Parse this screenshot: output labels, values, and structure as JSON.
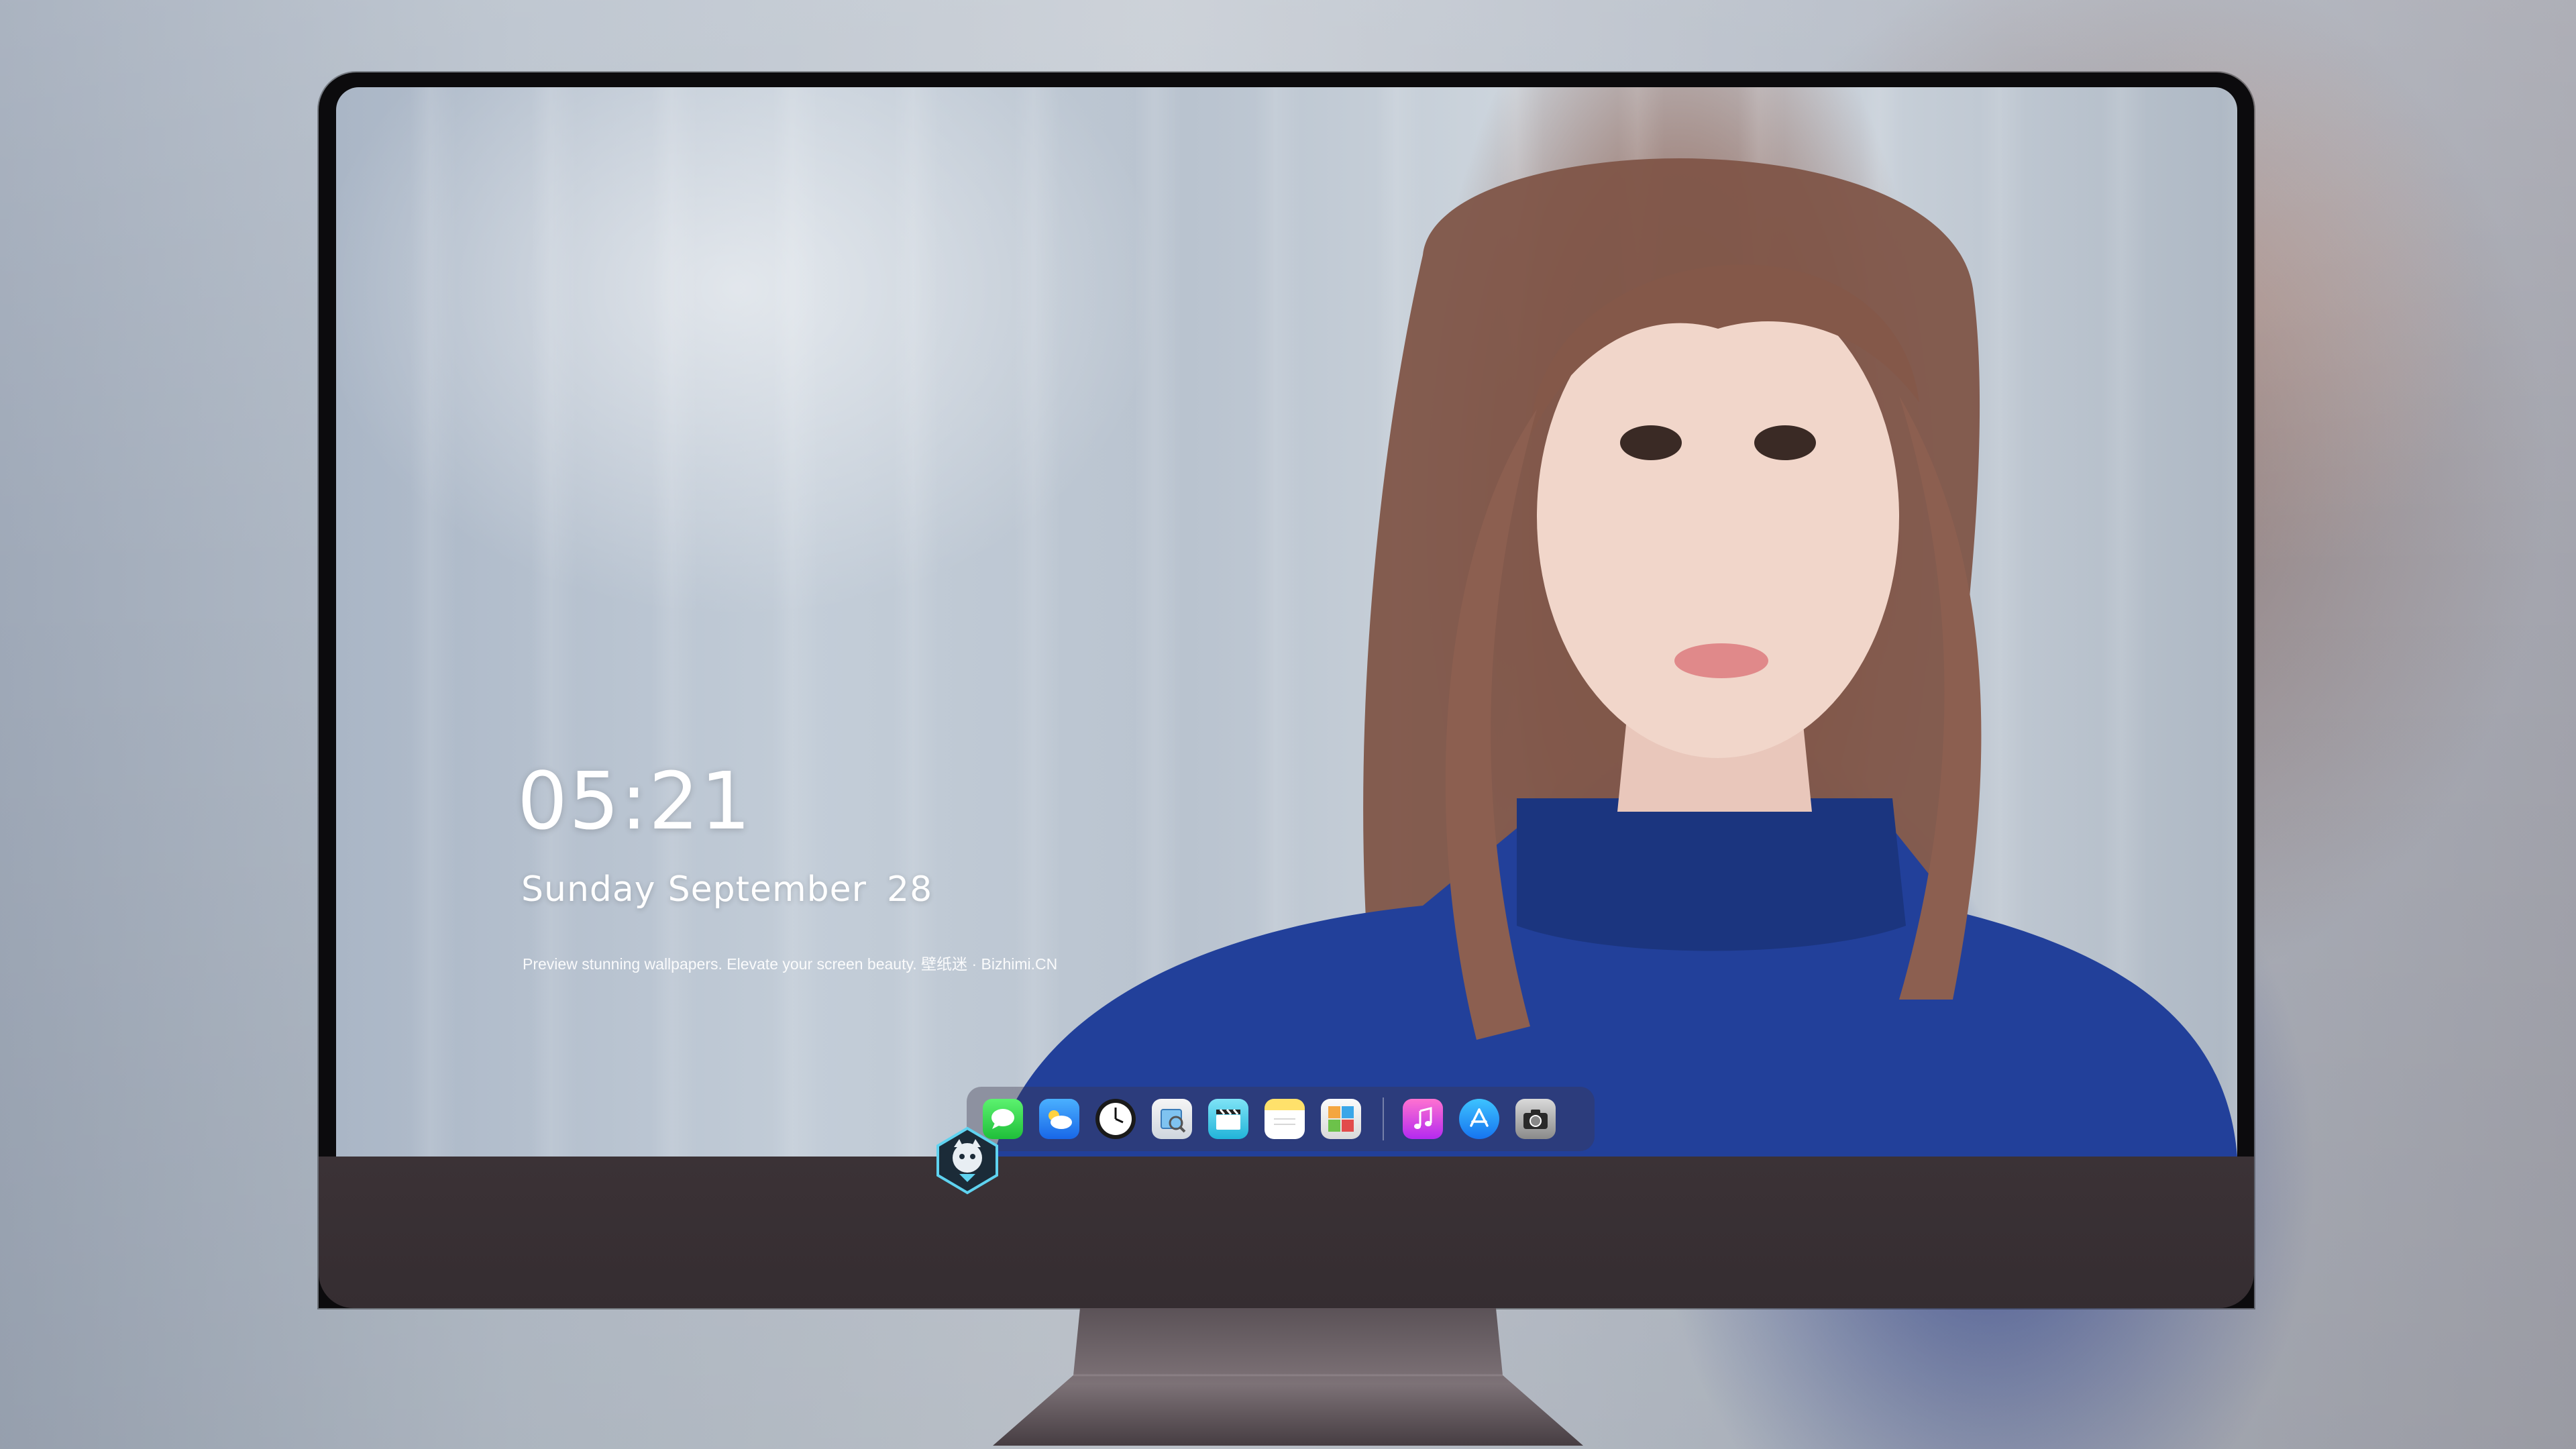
{
  "lock_screen": {
    "time": "05:21",
    "weekday": "Sunday",
    "month": "September",
    "day": "28",
    "tagline": "Preview stunning wallpapers. Elevate your screen beauty. 壁纸迷 · Bizhimi.CN"
  },
  "dock": {
    "items": [
      {
        "name": "messages",
        "icon": "speech-bubble-icon"
      },
      {
        "name": "weather",
        "icon": "cloud-icon"
      },
      {
        "name": "clock",
        "icon": "clock-icon"
      },
      {
        "name": "preview",
        "icon": "preview-icon"
      },
      {
        "name": "clips",
        "icon": "clapperboard-icon"
      },
      {
        "name": "notes",
        "icon": "notes-icon"
      },
      {
        "name": "photos",
        "icon": "photo-collage-icon"
      },
      {
        "name": "music",
        "icon": "music-note-icon"
      },
      {
        "name": "app-store",
        "icon": "app-store-icon"
      },
      {
        "name": "camera",
        "icon": "camera-icon"
      }
    ]
  },
  "colors": {
    "bezel": "#0c0b0d",
    "chin": "#3b3236",
    "sweater": "#213f92",
    "hair": "#8c5f50",
    "text": "#ffffff"
  },
  "logo": {
    "icon": "mascot-shield-icon"
  }
}
